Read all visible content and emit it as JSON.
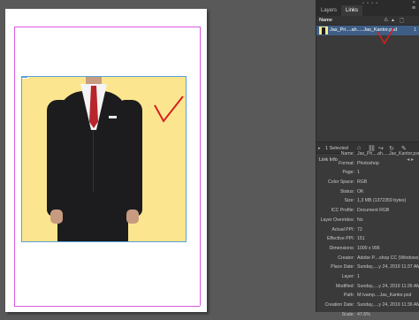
{
  "panel": {
    "tabs": [
      "Layers",
      "Links"
    ],
    "active_tab": "Links",
    "column_name": "Name",
    "link_item": {
      "name": "Jas_Pri....ah.....Jas_Kantor.psd",
      "status": "1"
    },
    "status_bar": {
      "selected": "1 Selected"
    },
    "info_title": "Link Info",
    "info": [
      {
        "k": "Name:",
        "v": "Jas_Pri....ah.....Jas_Kantor.psd"
      },
      {
        "k": "Format:",
        "v": "Photoshop"
      },
      {
        "k": "Page:",
        "v": "1"
      },
      {
        "k": "Color Space:",
        "v": "RGB"
      },
      {
        "k": "Status:",
        "v": "OK"
      },
      {
        "k": "Size:",
        "v": "1,3 MB (1372359 bytes)"
      },
      {
        "k": "ICC Profile:",
        "v": "Document RGB"
      },
      {
        "k": "Layer Overrides:",
        "v": "No"
      },
      {
        "k": "Actual PPI:",
        "v": "72"
      },
      {
        "k": "Effective PPI:",
        "v": "151"
      },
      {
        "k": "Dimensions:",
        "v": "1000 x 996"
      },
      {
        "k": "Creator:",
        "v": "Adobe P....shop CC (Windows)"
      },
      {
        "k": "Place Date:",
        "v": "Sunday,....y 24, 2019 11:37 AM"
      },
      {
        "k": "Layer:",
        "v": "1"
      },
      {
        "k": "Modified:",
        "v": "Sunday,....y 24, 2019 11:36 AM"
      },
      {
        "k": "Path:",
        "v": "M:\\vamp....Jas_Kantor.psd"
      },
      {
        "k": "Creation Date:",
        "v": "Sunday,....y 24, 2019 11:36 AM"
      },
      {
        "k": "Scale:",
        "v": "47.6%"
      }
    ]
  },
  "colors": {
    "accent_checkmark": "#d62020",
    "selection_row": "#3f5e86",
    "image_background": "#fbe68f"
  },
  "icons": [
    "warning-icon",
    "page-icon",
    "menu-icon",
    "relink-icon",
    "goto-link-icon",
    "update-link-icon",
    "edit-original-icon",
    "expand-icon"
  ]
}
